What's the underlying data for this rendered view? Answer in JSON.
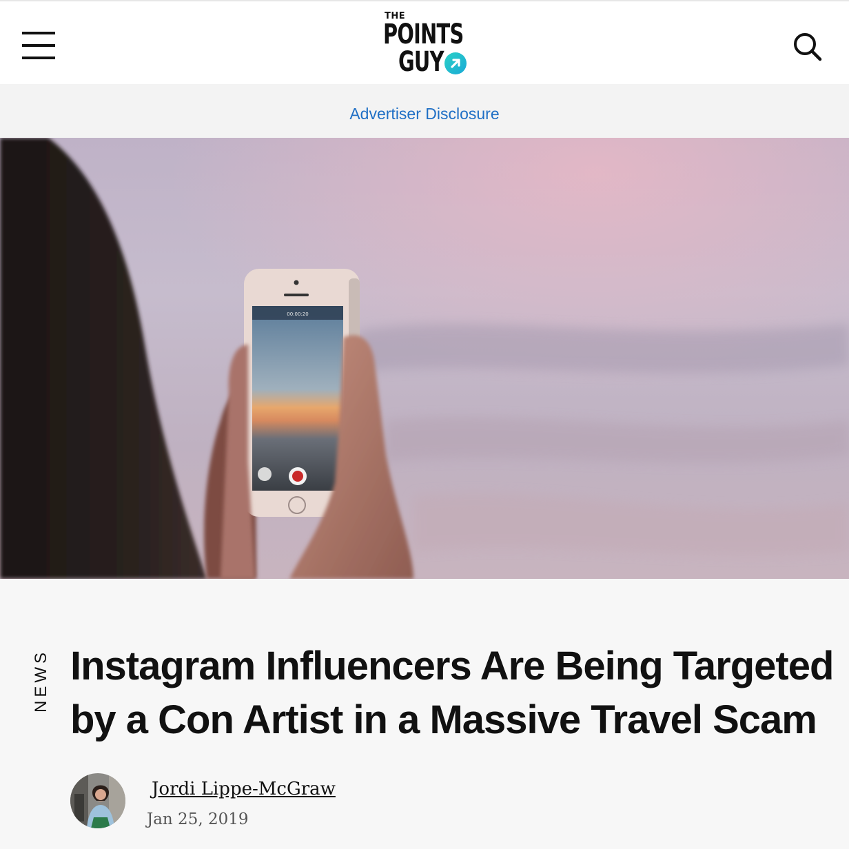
{
  "header": {
    "logo_the": "THE",
    "logo_points": "POINTS",
    "logo_guy": "GUY",
    "menu_icon": "hamburger-menu-icon",
    "search_icon": "search-icon",
    "brand_accent": "#22c1cf"
  },
  "disclosure": {
    "label": "Advertiser Disclosure",
    "color": "#1f6fc5"
  },
  "hero": {
    "phone_screen_time": "00:00:20"
  },
  "article": {
    "category": "NEWS",
    "title": "Instagram Influencers Are Being Targeted by a Con Artist in a Massive Travel Scam",
    "author": "Jordi Lippe-McGraw",
    "date": "Jan 25, 2019"
  }
}
